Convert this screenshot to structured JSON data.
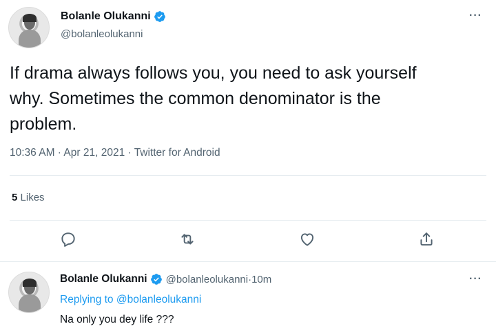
{
  "main_tweet": {
    "display_name": "Bolanle Olukanni",
    "handle": "@bolanleolukanni",
    "more_label": "···",
    "text_line1": "If drama always follows you, you need to ask yourself",
    "text_line2": "why. Sometimes the common denominator is the",
    "text_line3": "problem.",
    "time": "10:36 AM",
    "date": "Apr 21, 2021",
    "source": "Twitter for Android",
    "separator": " · ",
    "likes_count": "5",
    "likes_label": "Likes"
  },
  "actions": {
    "reply_icon": "reply-icon",
    "retweet_icon": "retweet-icon",
    "like_icon": "heart-icon",
    "share_icon": "share-icon"
  },
  "reply": {
    "display_name": "Bolanle Olukanni",
    "handle": "@bolanleolukanni",
    "time": "10m",
    "separator": " · ",
    "replying_prefix": "Replying to",
    "replying_to": "@bolanleolukanni",
    "text": "Na only you dey life ???",
    "more_label": "···"
  },
  "colors": {
    "accent": "#1d9bf0",
    "muted": "#536471",
    "text": "#0f1419",
    "divider": "#e6ecf0"
  }
}
